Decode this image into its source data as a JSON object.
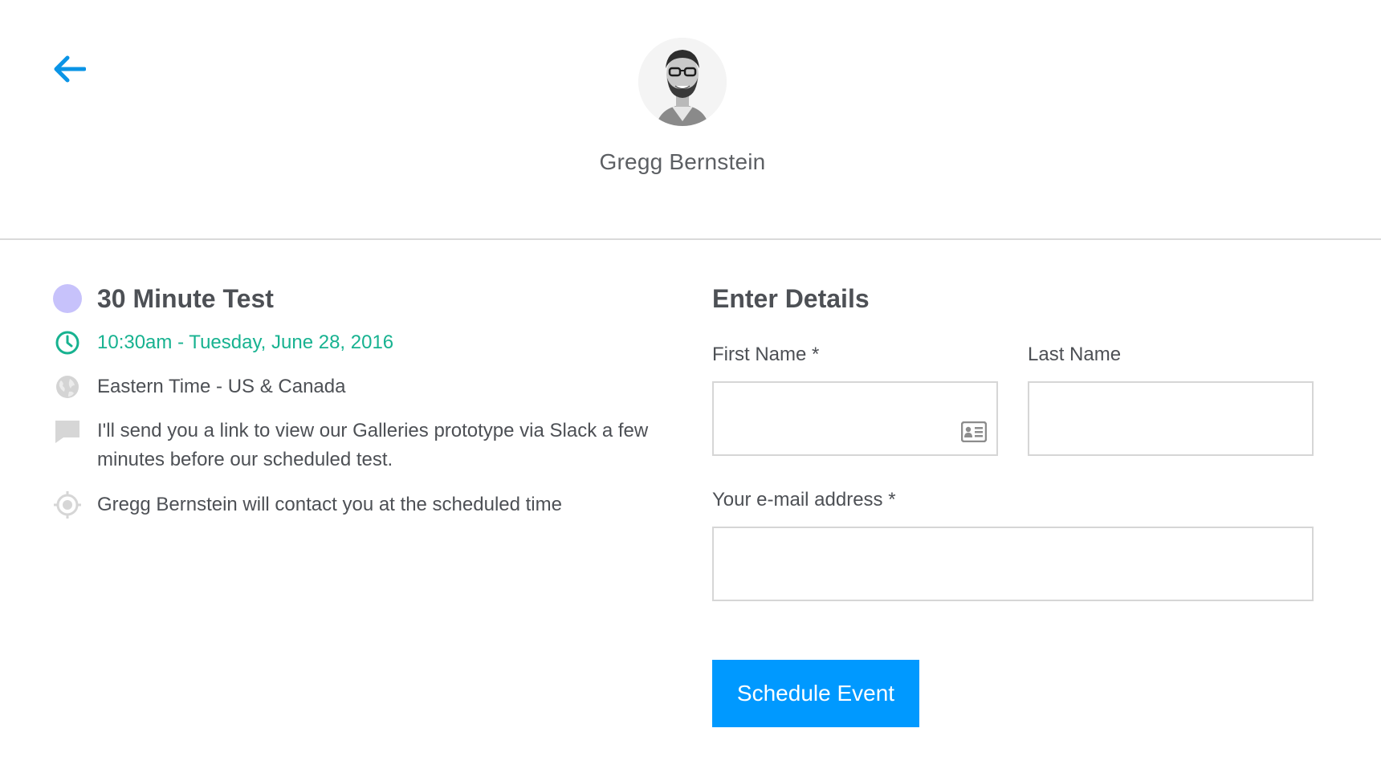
{
  "header": {
    "back_icon": "arrow-left-icon",
    "host_name": "Gregg Bernstein",
    "accent_color": "#0a94e6"
  },
  "event": {
    "title": "30 Minute Test",
    "color": "#c7c2fb",
    "time": "10:30am - Tuesday, June 28, 2016",
    "time_color": "#17b290",
    "timezone": "Eastern Time - US & Canada",
    "description": "I'll send you a link to view our Galleries prototype via Slack a few minutes before our scheduled test.",
    "contact": "Gregg Bernstein will contact you at the scheduled time",
    "icons": [
      "clock-icon",
      "globe-icon",
      "speech-bubble-icon",
      "location-target-icon"
    ]
  },
  "form": {
    "title": "Enter Details",
    "first_name_label": "First Name *",
    "first_name_value": "",
    "last_name_label": "Last Name",
    "last_name_value": "",
    "email_label": "Your e-mail address *",
    "email_value": "",
    "submit_label": "Schedule Event",
    "submit_color": "#0099ff"
  }
}
